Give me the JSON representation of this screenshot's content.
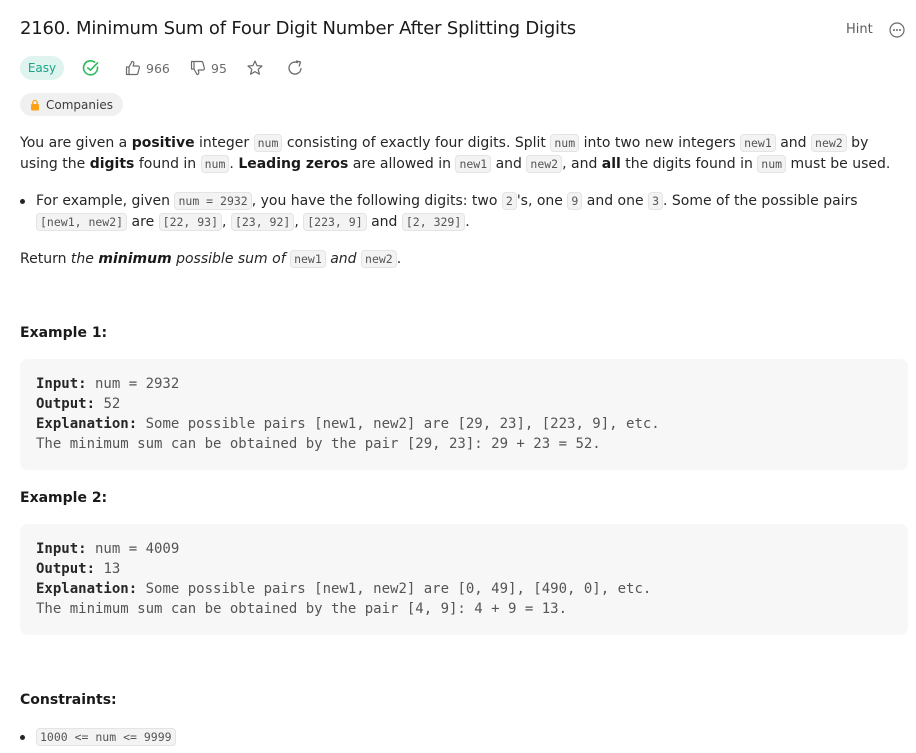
{
  "header": {
    "title": "2160. Minimum Sum of Four Digit Number After Splitting Digits",
    "hint_label": "Hint"
  },
  "meta": {
    "difficulty": "Easy",
    "likes": "966",
    "dislikes": "95",
    "companies_label": "Companies"
  },
  "description": {
    "p1": [
      {
        "t": "You are given a "
      },
      {
        "b": "positive"
      },
      {
        "t": " integer "
      },
      {
        "c": "num"
      },
      {
        "t": " consisting of exactly four digits. Split "
      },
      {
        "c": "num"
      },
      {
        "t": " into two new integers "
      },
      {
        "c": "new1"
      },
      {
        "t": " and "
      },
      {
        "c": "new2"
      },
      {
        "t": " by using the "
      },
      {
        "b": "digits"
      },
      {
        "t": " found in "
      },
      {
        "c": "num"
      },
      {
        "t": ". "
      },
      {
        "b": "Leading zeros"
      },
      {
        "t": " are allowed in "
      },
      {
        "c": "new1"
      },
      {
        "t": " and "
      },
      {
        "c": "new2"
      },
      {
        "t": ", and "
      },
      {
        "b": "all"
      },
      {
        "t": " the digits found in "
      },
      {
        "c": "num"
      },
      {
        "t": " must be used."
      }
    ],
    "bullet": [
      {
        "t": "For example, given "
      },
      {
        "c": "num = 2932"
      },
      {
        "t": ", you have the following digits: two "
      },
      {
        "c": "2"
      },
      {
        "t": "'s, one "
      },
      {
        "c": "9"
      },
      {
        "t": " and one "
      },
      {
        "c": "3"
      },
      {
        "t": ". Some of the possible pairs "
      },
      {
        "c": "[new1, new2]"
      },
      {
        "t": " are "
      },
      {
        "c": "[22, 93]"
      },
      {
        "t": ", "
      },
      {
        "c": "[23, 92]"
      },
      {
        "t": ", "
      },
      {
        "c": "[223, 9]"
      },
      {
        "t": " and "
      },
      {
        "c": "[2, 329]"
      },
      {
        "t": "."
      }
    ],
    "p2": [
      {
        "t": "Return "
      },
      {
        "i": "the "
      },
      {
        "bi": "minimum"
      },
      {
        "i": " possible sum of "
      },
      {
        "c": "new1"
      },
      {
        "i": " and "
      },
      {
        "c": "new2"
      },
      {
        "t": "."
      }
    ]
  },
  "examples": [
    {
      "title": "Example 1:",
      "input_label": "Input:",
      "input": " num = 2932",
      "output_label": "Output:",
      "output": " 52",
      "explanation_label": "Explanation:",
      "explanation": " Some possible pairs [new1, new2] are [29, 23], [223, 9], etc.",
      "explanation_2": "The minimum sum can be obtained by the pair [29, 23]: 29 + 23 = 52."
    },
    {
      "title": "Example 2:",
      "input_label": "Input:",
      "input": " num = 4009",
      "output_label": "Output:",
      "output": " 13",
      "explanation_label": "Explanation:",
      "explanation": " Some possible pairs [new1, new2] are [0, 49], [490, 0], etc.",
      "explanation_2": "The minimum sum can be obtained by the pair [4, 9]: 4 + 9 = 13."
    }
  ],
  "constraints": {
    "title": "Constraints:",
    "items": [
      "1000 <= num <= 9999"
    ]
  },
  "icons": {
    "solved": "check-circle",
    "like": "thumbs-up",
    "dislike": "thumbs-down",
    "favorite": "star",
    "share": "share-arrow",
    "more": "ellipsis-circle",
    "lock": "lock"
  },
  "colors": {
    "easy_text": "#1ca38a",
    "easy_bg": "#dff3ef",
    "lock": "#ffa116"
  }
}
